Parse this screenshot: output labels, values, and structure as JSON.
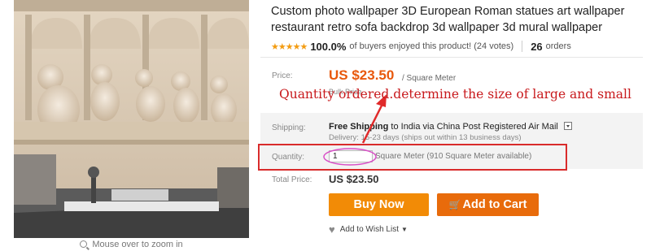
{
  "product": {
    "title": "Custom photo wallpaper 3D European Roman statues art wallpaper restaurant retro sofa backdrop 3d wallpaper 3d mural wallpaper",
    "stars": "★★★★★",
    "rating_pct": "100.0%",
    "rating_text": "of buyers enjoyed this product! (24 votes)",
    "orders_count": "26",
    "orders_label": "orders"
  },
  "price": {
    "label": "Price:",
    "value": "US $23.50",
    "unit": "/ Square Meter",
    "bulk_label": "Bulk Price"
  },
  "shipping": {
    "label": "Shipping:",
    "free": "Free Shipping",
    "dest": "to India via China Post Registered Air Mail",
    "delivery": "Delivery: 15-23 days (ships out within 13 business days)"
  },
  "quantity": {
    "label": "Quantity:",
    "value": "1",
    "unit_text": "Square Meter (910 Square Meter available)"
  },
  "total": {
    "label": "Total Price:",
    "value": "US $23.50"
  },
  "buttons": {
    "buy_now": "Buy Now",
    "add_to_cart": "Add to Cart"
  },
  "wishlist": {
    "label": "Add to Wish List"
  },
  "image": {
    "zoom_hint": "Mouse over to zoom in"
  },
  "annotation": {
    "text": "Quantity ordered.determine the size of large and small"
  },
  "colors": {
    "price": "#e8580c",
    "buy_now": "#f28b06",
    "add_to_cart": "#e86b0b",
    "annotation": "#c8191c",
    "stars": "#f39c12"
  }
}
